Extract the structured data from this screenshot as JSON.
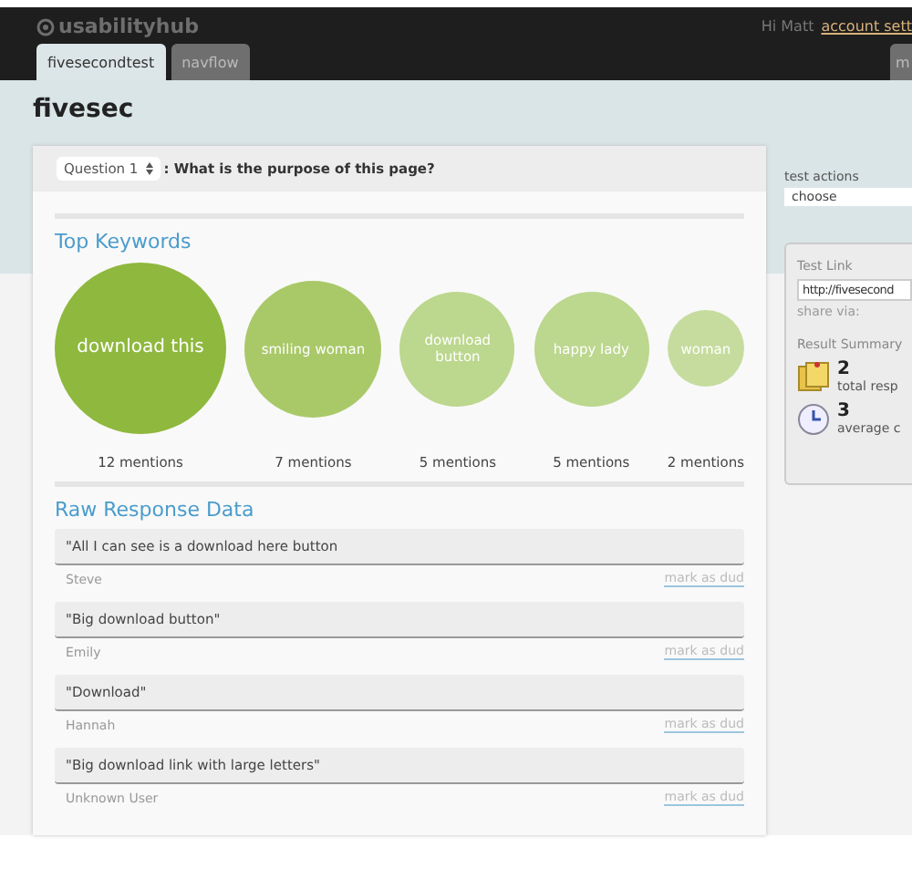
{
  "header": {
    "logo": "usabilityhub",
    "greeting": "Hi Matt",
    "account_link": "account sett"
  },
  "tabs": [
    {
      "label": "fivesecondtest",
      "selected": true
    },
    {
      "label": "navflow",
      "selected": false
    }
  ],
  "edge_tab": {
    "label": "m"
  },
  "page_title": "fivesec",
  "question": {
    "select": "Question 1",
    "text": ": What is the purpose of this page?"
  },
  "keywords": {
    "title": "Top Keywords",
    "items": [
      {
        "label": "download this",
        "mentions": "12 mentions",
        "color": "#8fb83e"
      },
      {
        "label": "smiling woman",
        "mentions": "7 mentions",
        "color": "#a9c969"
      },
      {
        "label": "download button",
        "mentions": "5 mentions",
        "color": "#bcd78e"
      },
      {
        "label": "happy lady",
        "mentions": "5 mentions",
        "color": "#bcd78e"
      },
      {
        "label": "woman",
        "mentions": "2 mentions",
        "color": "#c6dc9f"
      }
    ]
  },
  "responses": {
    "title": "Raw Response Data",
    "items": [
      {
        "text": "\"All I can see is a download here button",
        "author": "Steve",
        "action": "mark as dud"
      },
      {
        "text": "\"Big download button\"",
        "author": "Emily",
        "action": "mark as dud"
      },
      {
        "text": "\"Download\"",
        "author": "Hannah",
        "action": "mark as dud"
      },
      {
        "text": "\"Big download link with large letters\"",
        "author": "Unknown User",
        "action": "mark as dud"
      }
    ]
  },
  "sidebar": {
    "actions_label": "test actions",
    "actions_select": "choose",
    "test_link": {
      "title": "Test Link",
      "value": "http://fivesecond",
      "share": "share via:"
    },
    "summary": {
      "title": "Result Summary",
      "stats": [
        {
          "kind": "notes",
          "value": "2",
          "label": "total resp"
        },
        {
          "kind": "clock",
          "value": "3",
          "label": "average c"
        }
      ]
    }
  }
}
